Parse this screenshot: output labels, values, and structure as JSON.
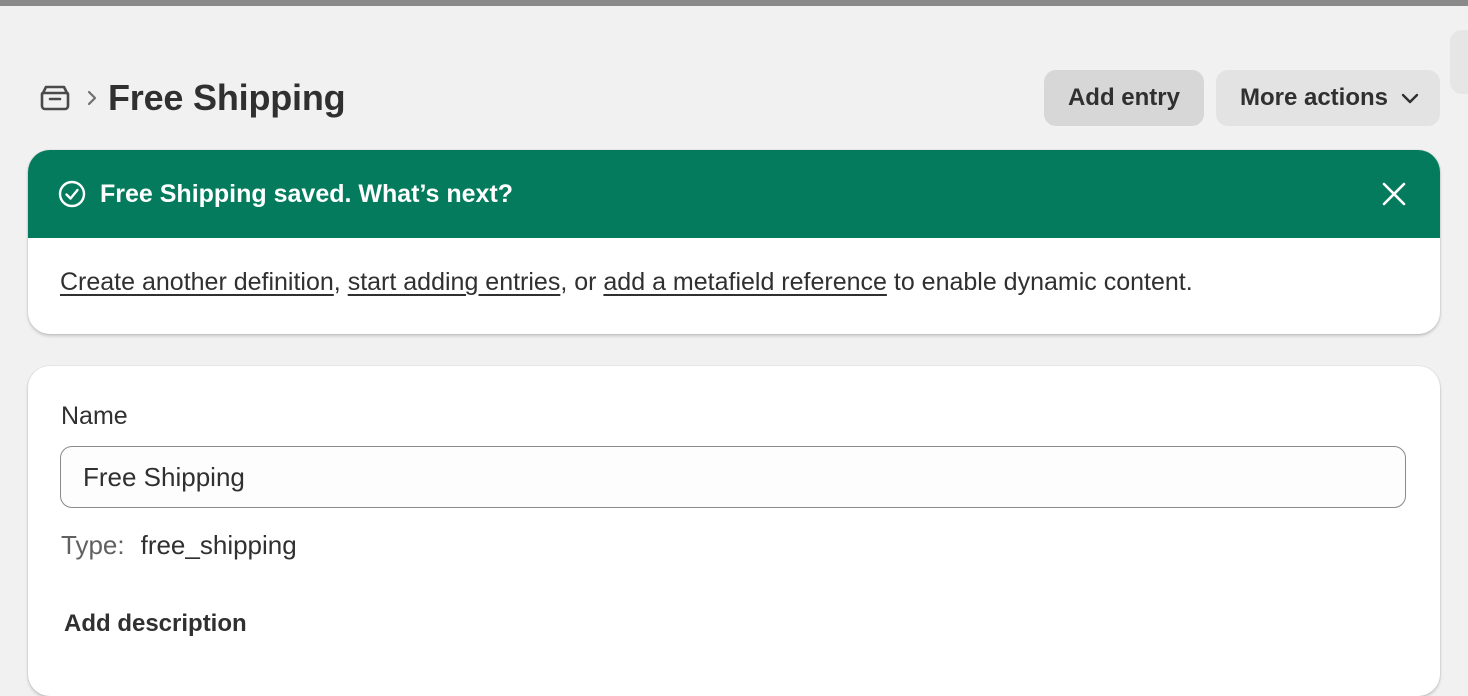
{
  "header": {
    "breadcrumb_icon": "metaobject-icon",
    "breadcrumb_separator": "›",
    "title": "Free Shipping",
    "actions": {
      "add_entry_label": "Add entry",
      "more_actions_label": "More actions"
    }
  },
  "banner": {
    "status": "success",
    "color": "#047b5d",
    "title": "Free Shipping saved. What’s next?",
    "links": {
      "create_definition": "Create another definition",
      "start_entries": "start adding entries",
      "add_reference": "add a metafield reference"
    },
    "text": {
      "sep1": ", ",
      "sep2": ", or ",
      "tail": " to enable dynamic content."
    }
  },
  "definition": {
    "name_label": "Name",
    "name_value": "Free Shipping",
    "type_label": "Type:",
    "type_value": "free_shipping",
    "add_description_label": "Add description"
  }
}
